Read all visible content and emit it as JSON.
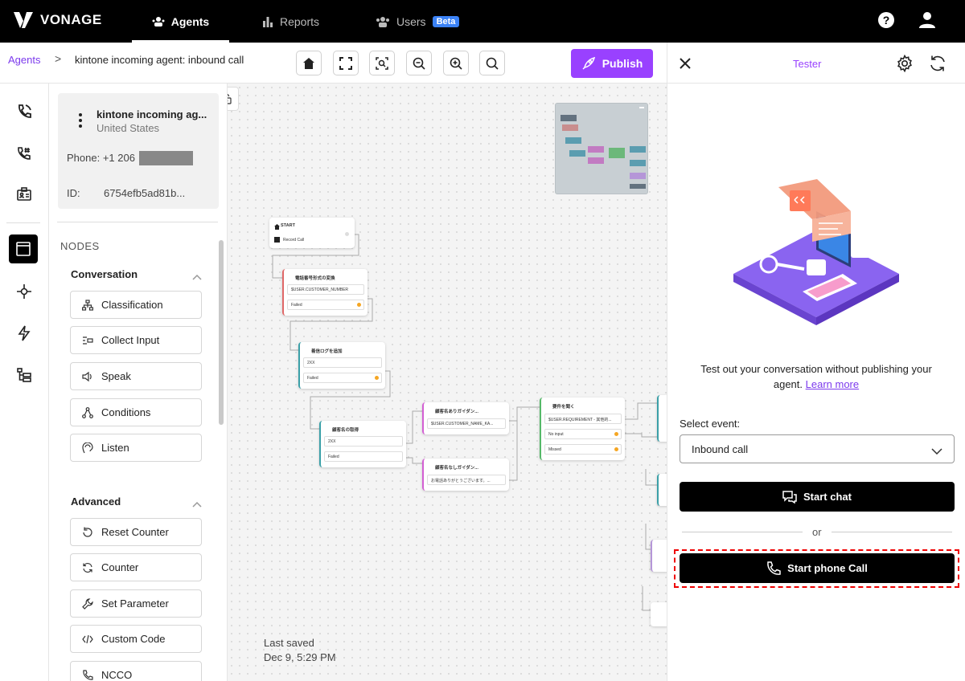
{
  "topbar": {
    "logo_text": "VONAGE",
    "tabs": [
      {
        "label": "Agents",
        "icon": "agents-icon"
      },
      {
        "label": "Reports",
        "icon": "bar-chart-icon"
      },
      {
        "label": "Users",
        "icon": "users-icon",
        "badge": "Beta"
      }
    ]
  },
  "breadcrumb": {
    "root": "Agents",
    "separator": ">",
    "current": "kintone incoming agent: inbound call"
  },
  "toolbar": {
    "publish_label": "Publish"
  },
  "agent_card": {
    "name": "kintone incoming ag...",
    "country": "United States",
    "phone_label": "Phone:",
    "phone_value": "+1 206",
    "id_label": "ID:",
    "id_value": "6754efb5ad81b..."
  },
  "nodes": {
    "heading": "NODES",
    "conversation": {
      "title": "Conversation",
      "items": [
        "Classification",
        "Collect Input",
        "Speak",
        "Conditions",
        "Listen"
      ]
    },
    "advanced": {
      "title": "Advanced",
      "items": [
        "Reset Counter",
        "Counter",
        "Set Parameter",
        "Custom Code",
        "NCCO"
      ]
    }
  },
  "flow": {
    "start": {
      "title": "START",
      "row": "Record Call"
    },
    "n1": {
      "title": "電話番号形式の変換",
      "rows": [
        "$USER.CUSTOMER_NUMBER",
        "Failed"
      ]
    },
    "n2": {
      "title": "着信ログを追加",
      "rows": [
        "2XX",
        "Failed"
      ]
    },
    "n3": {
      "title": "顧客名の取得",
      "rows": [
        "2XX",
        "Failed"
      ]
    },
    "n4": {
      "title": "顧客名ありガイダン...",
      "rows": [
        "$USER.CUSTOMER_NAME_KA..."
      ]
    },
    "n5": {
      "title": "顧客名なしガイダン...",
      "rows": [
        "お電話ありがとうございます。..."
      ]
    },
    "n6": {
      "title": "要件を聞く",
      "rows": [
        "$USER.REQUIREMENT - 其他的...",
        "No input",
        "Missed"
      ]
    }
  },
  "last_saved": {
    "label": "Last saved",
    "value": "Dec 9, 5:29 PM"
  },
  "tester": {
    "title": "Tester",
    "description": "Test out your conversation without publishing your agent.",
    "learn_more": "Learn more",
    "select_label": "Select event:",
    "select_value": "Inbound call",
    "start_chat": "Start chat",
    "or": "or",
    "start_call": "Start phone Call"
  },
  "colors": {
    "accent": "#9941ff",
    "link": "#7c3aed",
    "topbar": "#000000",
    "highlight": "#e00000"
  }
}
